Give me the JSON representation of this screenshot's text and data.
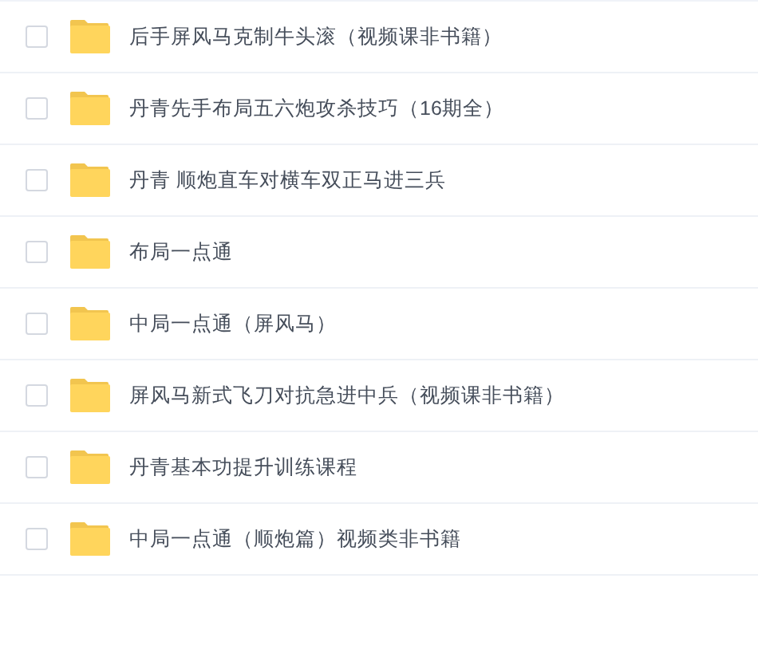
{
  "files": [
    {
      "name": "后手屏风马克制牛头滚（视频课非书籍）",
      "checked": false
    },
    {
      "name": "丹青先手布局五六炮攻杀技巧（16期全）",
      "checked": false
    },
    {
      "name": "丹青 顺炮直车对横车双正马进三兵",
      "checked": false
    },
    {
      "name": "布局一点通",
      "checked": false
    },
    {
      "name": "中局一点通（屏风马）",
      "checked": false
    },
    {
      "name": "屏风马新式飞刀对抗急进中兵（视频课非书籍）",
      "checked": false
    },
    {
      "name": "丹青基本功提升训练课程",
      "checked": false
    },
    {
      "name": "中局一点通（顺炮篇）视频类非书籍",
      "checked": false
    }
  ]
}
